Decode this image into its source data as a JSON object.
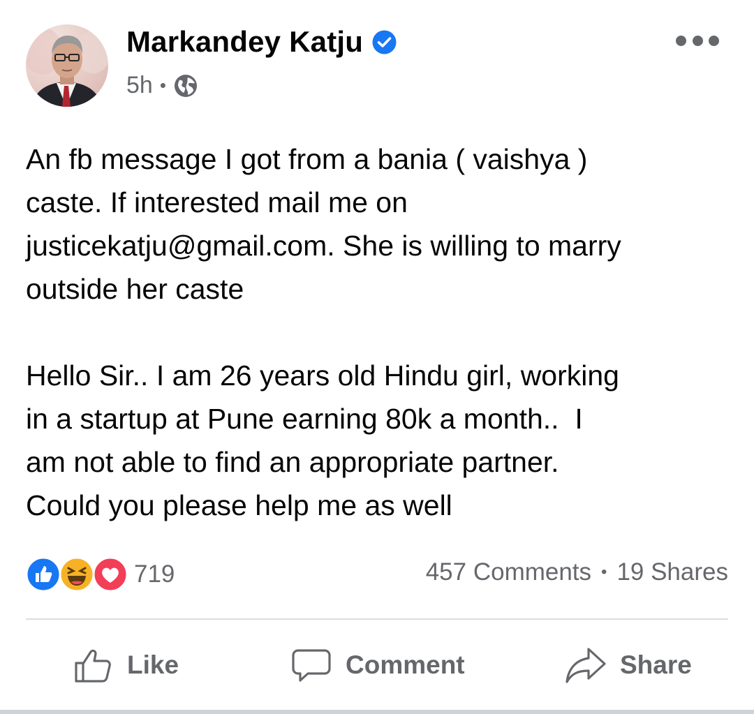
{
  "post": {
    "author": {
      "name": "Markandey Katju",
      "verified_icon": "verified-badge-icon",
      "avatar": "profile-photo"
    },
    "timestamp": "5h",
    "meta_separator": "•",
    "privacy_icon": "globe-icon",
    "more_icon": "more-options-icon",
    "text": "An fb message I got from a bania ( vaishya )\ncaste. If interested mail me on\njusticekatju@gmail.com. She is willing to marry\noutside her caste\n\nHello Sir.. I am 26 years old Hindu girl, working\nin a startup at Pune earning 80k a month..  I\nam not able to find an appropriate partner.\nCould you please help me as well"
  },
  "engagement": {
    "reaction_icons": [
      "like-reaction-icon",
      "haha-reaction-icon",
      "love-reaction-icon"
    ],
    "reaction_count": "719",
    "comments": "457 Comments",
    "separator": "•",
    "shares": "19 Shares"
  },
  "actions": {
    "like_label": "Like",
    "comment_label": "Comment",
    "share_label": "Share"
  },
  "colors": {
    "text_primary": "#050505",
    "text_secondary": "#65676b",
    "verified_blue": "#1877f2",
    "like_blue": "#1877f2",
    "love_red": "#f33e58",
    "haha_yellow": "#f7b125",
    "divider": "#dadde1"
  }
}
